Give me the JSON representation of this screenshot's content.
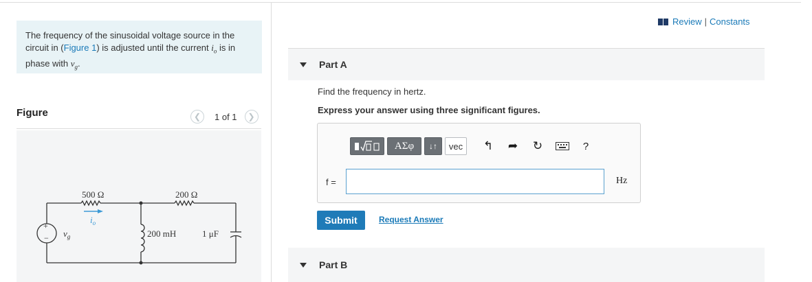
{
  "problem": {
    "text_before_link": "The frequency of the sinusoidal voltage source in the circuit in (",
    "figure_link": "Figure 1",
    "text_after_link": ") is adjusted until the current ",
    "current_symbol": "i",
    "current_sub": "o",
    "text_middle": " is in phase with ",
    "voltage_symbol": "v",
    "voltage_sub": "g",
    "text_end": "."
  },
  "figure": {
    "title": "Figure",
    "pager_text": "1 of 1",
    "prev_icon": "chevron-left-icon",
    "next_icon": "chevron-right-icon",
    "circuit": {
      "r1": "500 Ω",
      "r2": "200 Ω",
      "inductor": "200 mH",
      "capacitor": "1 μF",
      "current": "i",
      "current_sub": "o",
      "source": "v",
      "source_sub": "g",
      "plus": "+",
      "minus": "−"
    }
  },
  "header": {
    "review": "Review",
    "separator": "|",
    "constants": "Constants"
  },
  "part_a": {
    "title": "Part A",
    "prompt": "Find the frequency in hertz.",
    "instructions": "Express your answer using three significant figures.",
    "toolbar": {
      "templates_icon": "templates-icon",
      "greek": "ΑΣφ",
      "updown": "↓↑",
      "vec": "vec",
      "undo_icon": "undo-icon",
      "redo_icon": "redo-icon",
      "reset_icon": "reset-icon",
      "keyboard_icon": "keyboard-icon",
      "help": "?"
    },
    "variable": "f =",
    "answer_value": "",
    "unit": "Hz",
    "submit": "Submit",
    "request_answer": "Request Answer"
  },
  "part_b": {
    "title": "Part B"
  },
  "colors": {
    "accent": "#1f7bb8",
    "link": "#1a7ab8",
    "intro_bg": "#e8f3f6",
    "part_bar_bg": "#f4f5f6",
    "toolbar_dark": "#6b7075"
  }
}
